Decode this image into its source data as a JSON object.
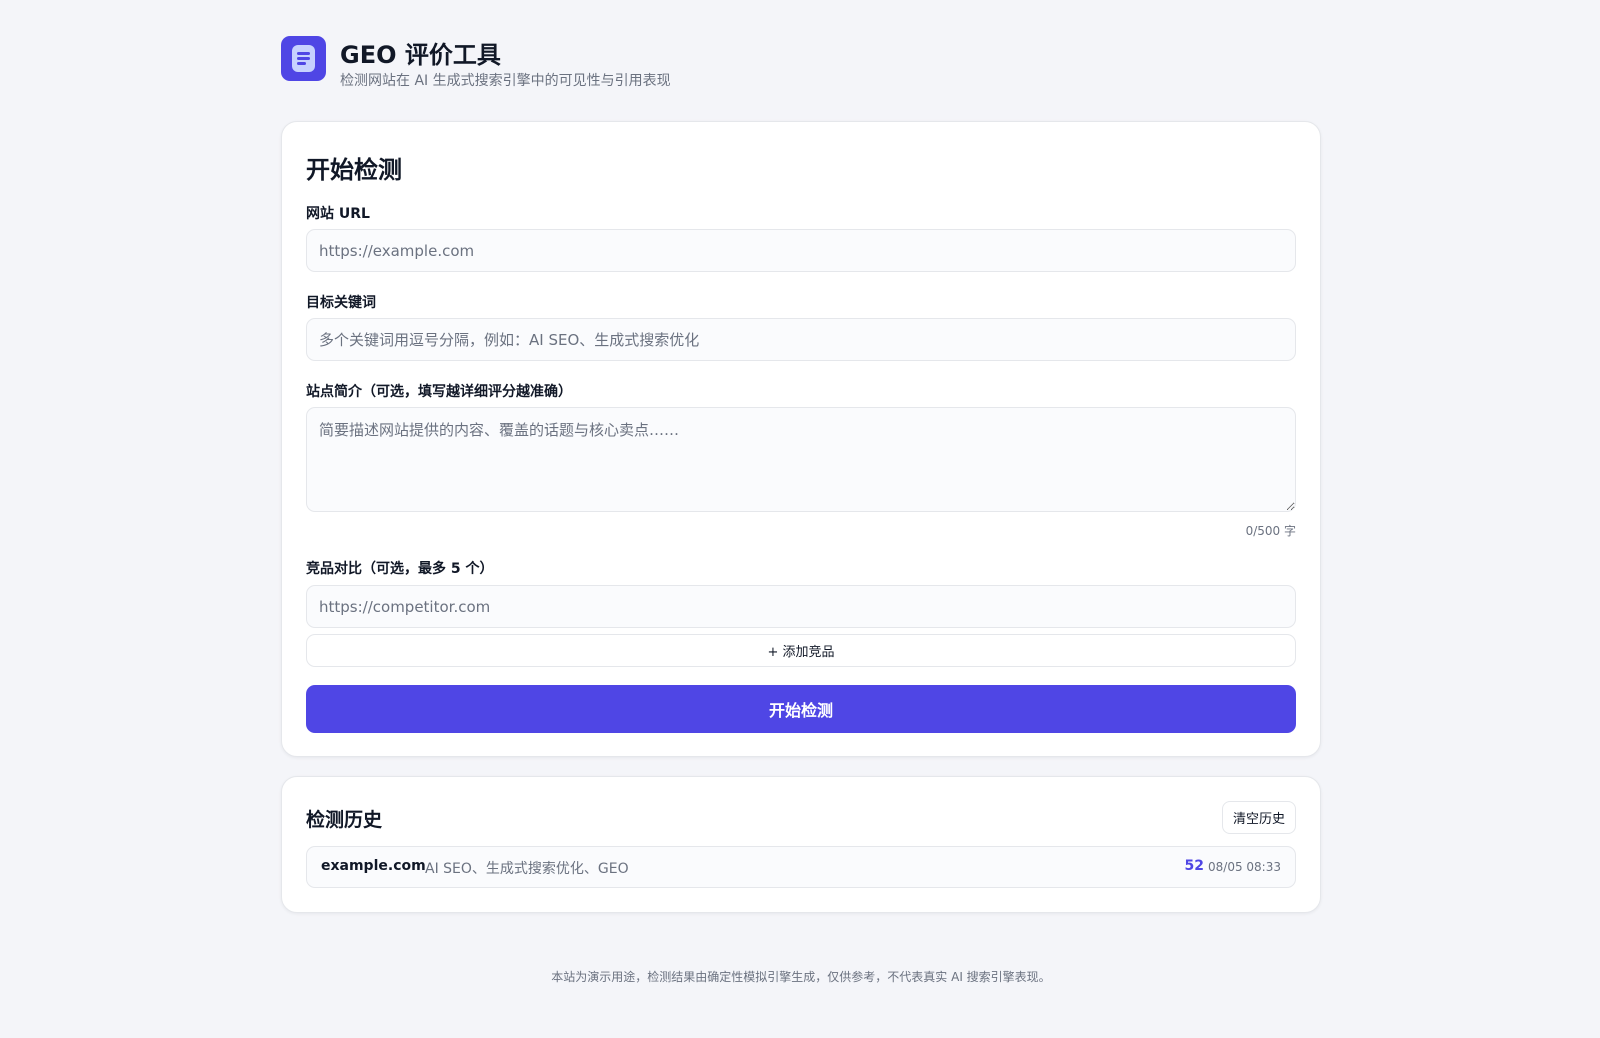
{
  "header": {
    "title": "GEO 评价工具",
    "subtitle": "检测网站在 AI 生成式搜索引擎中的可见性与引用表现",
    "logo_icon": "document-icon"
  },
  "form": {
    "title": "开始检测",
    "url": {
      "label": "网站 URL",
      "value": "",
      "placeholder": "https://example.com"
    },
    "keywords": {
      "label": "目标关键词",
      "value": "",
      "placeholder": "多个关键词用逗号分隔，例如：AI SEO、生成式搜索优化"
    },
    "description": {
      "label": "站点简介（可选，填写越详细评分越准确）",
      "value": "",
      "placeholder": "简要描述网站提供的内容、覆盖的话题与核心卖点……",
      "counter": "0/500 字"
    },
    "competitors": {
      "label": "竞品对比（可选，最多 5 个）",
      "value": "",
      "placeholder": "https://competitor.com",
      "add_label": "+ 添加竞品"
    },
    "submit_label": "开始检测"
  },
  "history": {
    "title": "检测历史",
    "clear_label": "清空历史",
    "items": [
      {
        "domain": "example.com",
        "keywords": "AI SEO、生成式搜索优化、GEO",
        "score": "52",
        "time": "08/05 08:33"
      }
    ]
  },
  "footer": {
    "text": "本站为演示用途，检测结果由确定性模拟引擎生成，仅供参考，不代表真实 AI 搜索引擎表现。"
  },
  "colors": {
    "accent": "#4f46e5",
    "background": "#f4f5f9",
    "muted_text": "#6b7280",
    "border": "#e5e7eb"
  }
}
